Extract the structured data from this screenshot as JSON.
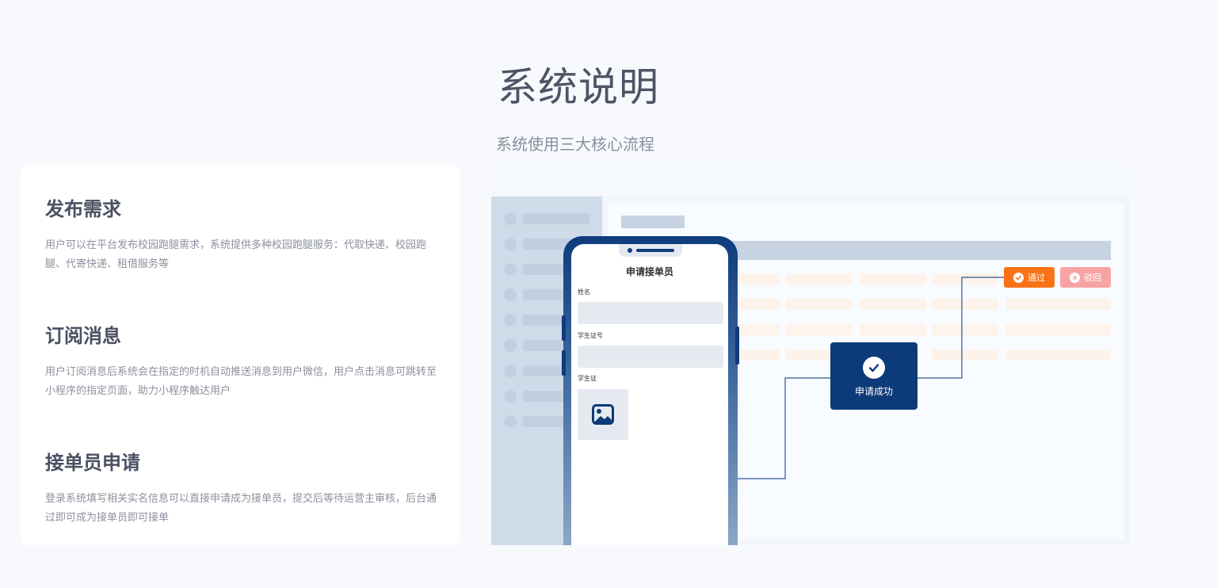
{
  "header": {
    "title": "系统说明",
    "subtitle": "系统使用三大核心流程"
  },
  "features": [
    {
      "title": "发布需求",
      "description": "用户可以在平台发布校园跑腿需求，系统提供多种校园跑腿服务：代取快递、校园跑腿、代寄快递、租借服务等"
    },
    {
      "title": "订阅消息",
      "description": "用户订阅消息后系统会在指定的时机自动推送消息到用户微信，用户点击消息可跳转至小程序的指定页面，助力小程序触达用户"
    },
    {
      "title": "接单员申请",
      "description": "登录系统填写相关实名信息可以直接申请成为接单员，提交后等待运营主审核，后台通过即可成为接单员即可接单"
    }
  ],
  "illustration": {
    "approve_label": "通过",
    "reject_label": "驳回",
    "success_label": "申请成功",
    "phone": {
      "title": "申请接单员",
      "name_label": "姓名",
      "student_id_label": "学生证号",
      "student_card_label": "学生证"
    }
  },
  "colors": {
    "primary": "#0d3a78",
    "approve": "#f97316",
    "reject": "#f8a3a3",
    "background": "#f7f9fd"
  }
}
